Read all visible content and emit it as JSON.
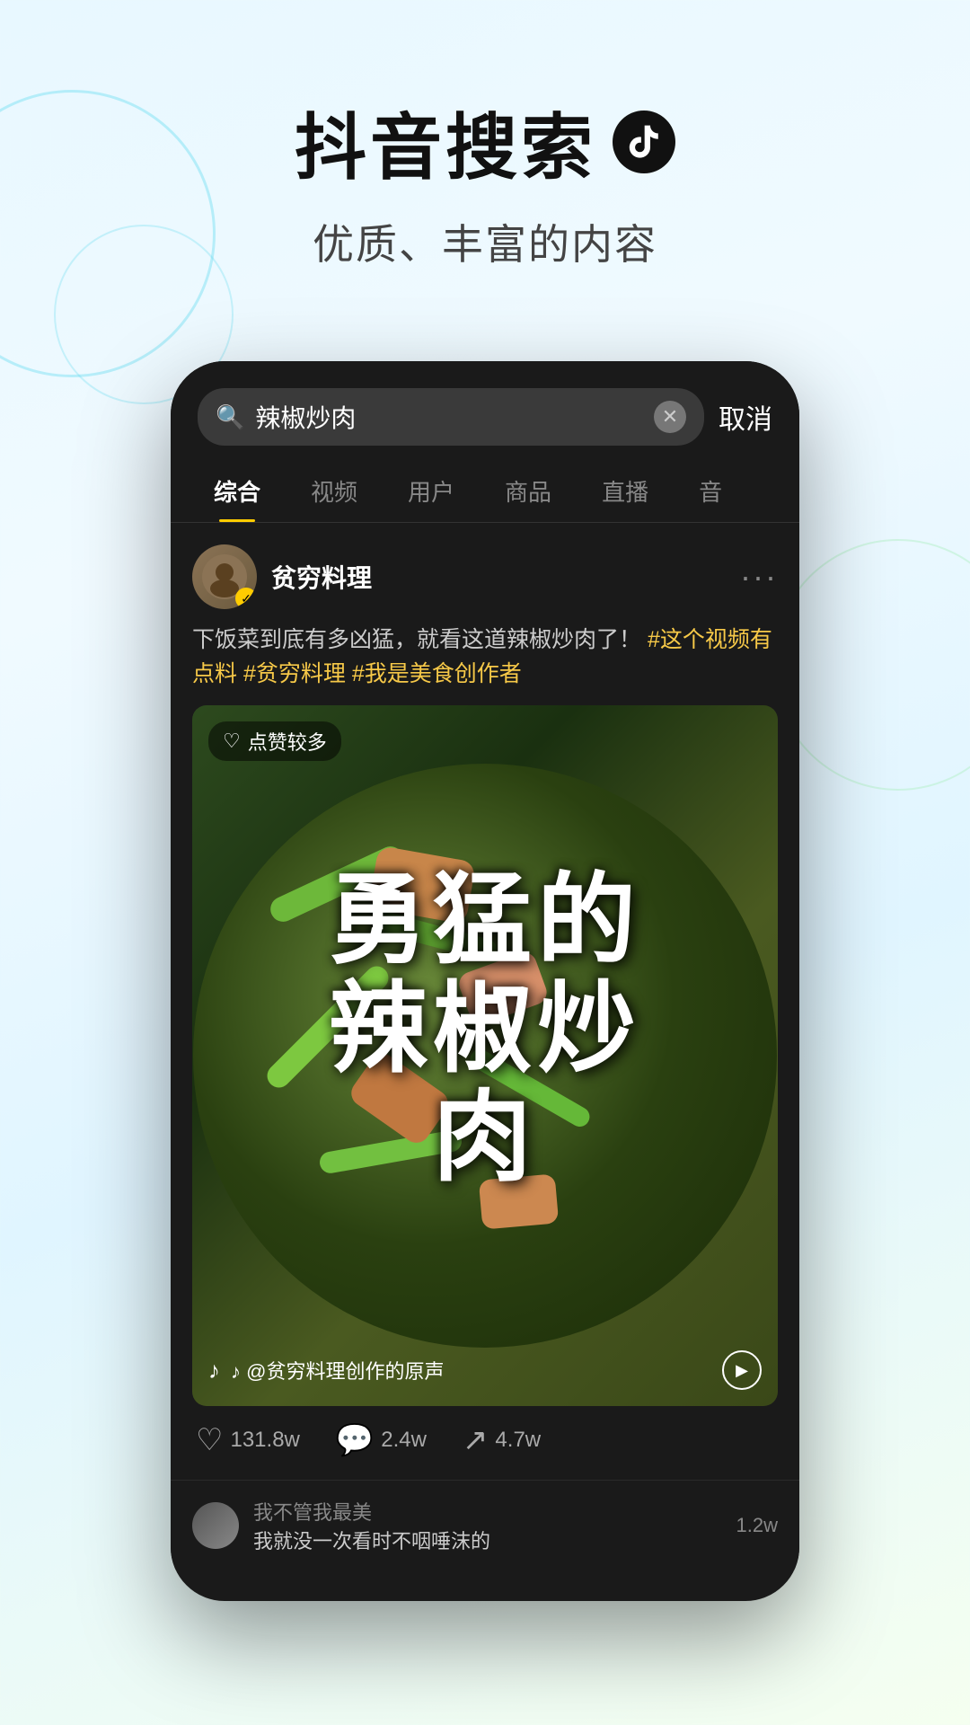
{
  "header": {
    "main_title": "抖音搜索",
    "sub_title": "优质、丰富的内容"
  },
  "search": {
    "query": "辣椒炒肉",
    "cancel_label": "取消"
  },
  "tabs": [
    {
      "label": "综合",
      "active": true
    },
    {
      "label": "视频",
      "active": false
    },
    {
      "label": "用户",
      "active": false
    },
    {
      "label": "商品",
      "active": false
    },
    {
      "label": "直播",
      "active": false
    },
    {
      "label": "音",
      "active": false
    }
  ],
  "post": {
    "author": "贫穷料理",
    "description": "下饭菜到底有多凶猛，就看这道辣椒炒肉了！",
    "hashtags": [
      "#这个视频有点料",
      "#贫穷料理",
      "#我是美食创作者"
    ],
    "likes_badge": "点赞较多",
    "video_text": "勇猛的辣椒炒肉",
    "sound_text": "@贫穷料理创作的原声",
    "more_icon": "···"
  },
  "interactions": {
    "likes": "131.8w",
    "comments": "2.4w",
    "shares": "4.7w"
  },
  "comment_preview": {
    "user": "我不管我最美",
    "text": "我就没一次看时不咽唾沫的",
    "count": "1.2w"
  }
}
